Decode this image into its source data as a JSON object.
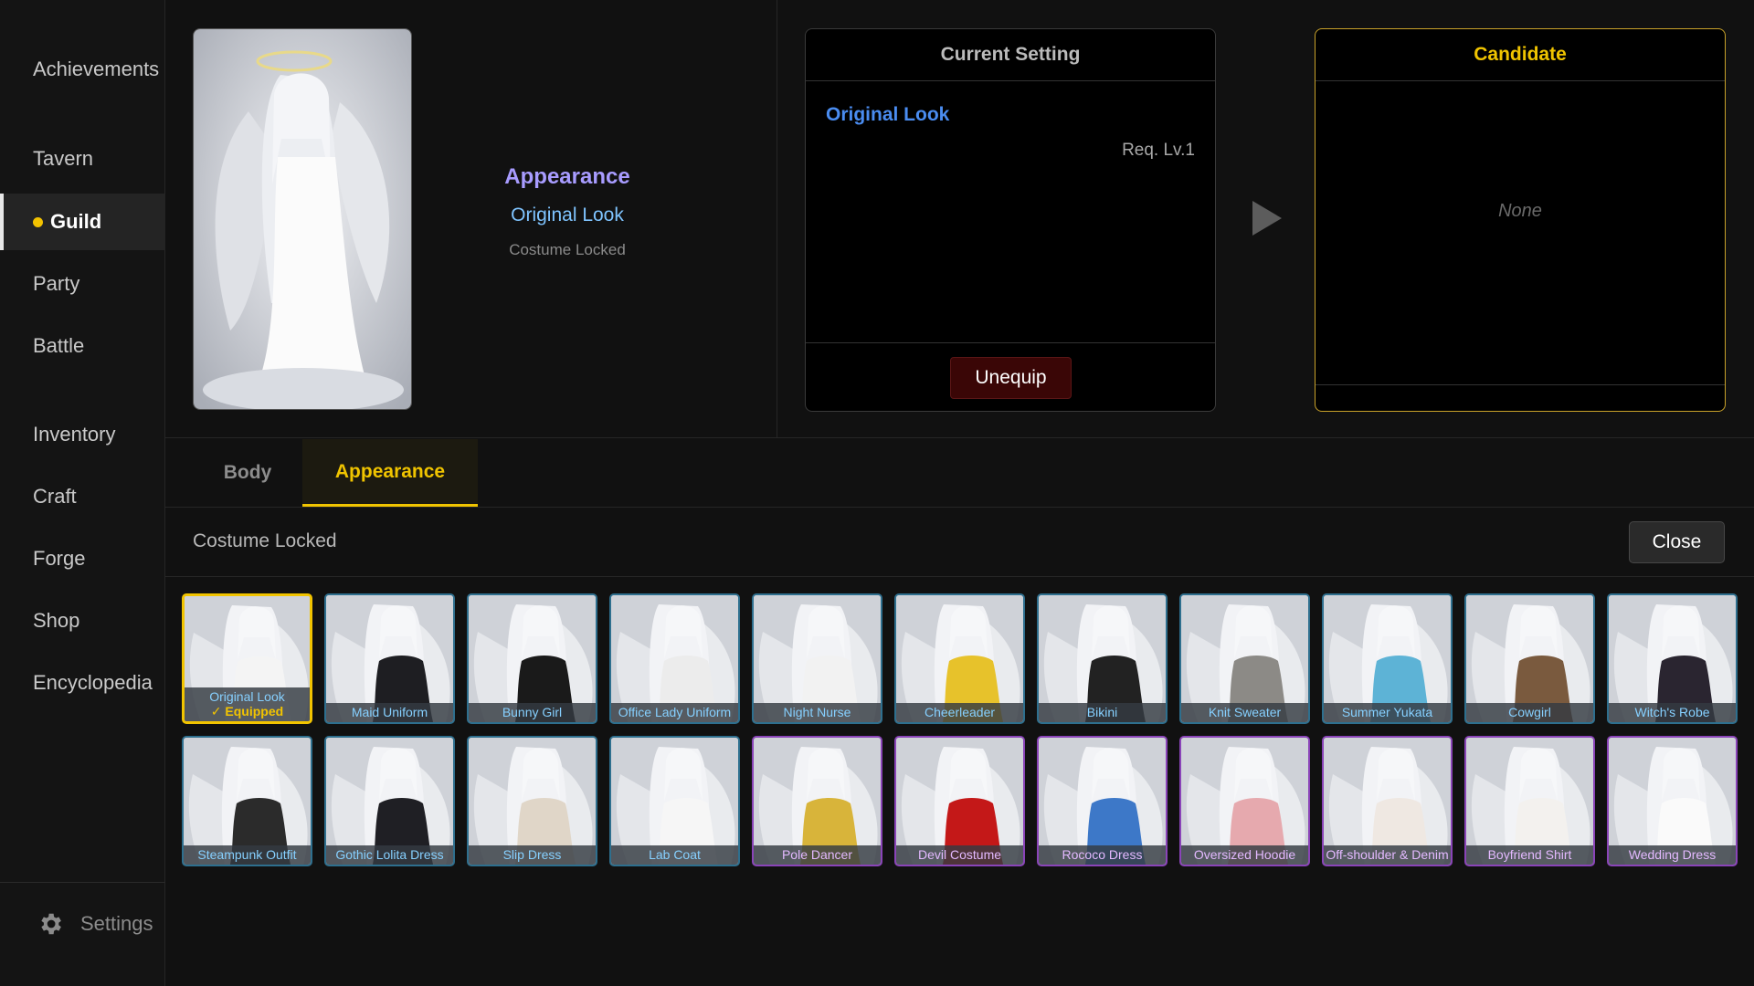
{
  "sidebar": {
    "items": [
      {
        "label": "Achievements",
        "active": false
      },
      {
        "label": "Tavern",
        "active": false
      },
      {
        "label": "Guild",
        "active": true
      },
      {
        "label": "Party",
        "active": false
      },
      {
        "label": "Battle",
        "active": false
      },
      {
        "label": "Inventory",
        "active": false
      },
      {
        "label": "Craft",
        "active": false
      },
      {
        "label": "Forge",
        "active": false
      },
      {
        "label": "Shop",
        "active": false
      },
      {
        "label": "Encyclopedia",
        "active": false
      }
    ],
    "settings_label": "Settings"
  },
  "summary": {
    "heading": "Appearance",
    "current_look": "Original Look",
    "status": "Costume Locked"
  },
  "current_setting": {
    "title": "Current Setting",
    "name": "Original Look",
    "requirement": "Req. Lv.1",
    "unequip_label": "Unequip"
  },
  "candidate": {
    "title": "Candidate",
    "value": "None"
  },
  "tabs": [
    {
      "label": "Body",
      "active": false
    },
    {
      "label": "Appearance",
      "active": true
    }
  ],
  "costume_panel": {
    "status": "Costume Locked",
    "close_label": "Close"
  },
  "costumes": [
    {
      "name": "Original Look",
      "badge": "✓ Equipped",
      "rarity": "selected",
      "outfit": "#f4f4f4"
    },
    {
      "name": "Maid Uniform",
      "rarity": "common",
      "outfit": "#1e1e22"
    },
    {
      "name": "Bunny Girl",
      "rarity": "common",
      "outfit": "#1a1a1a"
    },
    {
      "name": "Office Lady Uniform",
      "rarity": "common",
      "outfit": "#ececec"
    },
    {
      "name": "Night Nurse",
      "rarity": "common",
      "outfit": "#f2f2f2"
    },
    {
      "name": "Cheerleader",
      "rarity": "common",
      "outfit": "#e7c22b"
    },
    {
      "name": "Bikini",
      "rarity": "common",
      "outfit": "#222222"
    },
    {
      "name": "Knit Sweater",
      "rarity": "common",
      "outfit": "#8c8a86"
    },
    {
      "name": "Summer Yukata",
      "rarity": "common",
      "outfit": "#5db3d6"
    },
    {
      "name": "Cowgirl",
      "rarity": "common",
      "outfit": "#7a5a3e"
    },
    {
      "name": "Witch's Robe",
      "rarity": "common",
      "outfit": "#2a2530"
    },
    {
      "name": "Steampunk Outfit",
      "rarity": "common",
      "outfit": "#2b2b2b"
    },
    {
      "name": "Gothic Lolita Dress",
      "rarity": "common",
      "outfit": "#1f1f24"
    },
    {
      "name": "Slip Dress",
      "rarity": "common",
      "outfit": "#e0d6c8"
    },
    {
      "name": "Lab Coat",
      "rarity": "common",
      "outfit": "#f6f6f6"
    },
    {
      "name": "Pole Dancer",
      "rarity": "rare",
      "outfit": "#d8b43a"
    },
    {
      "name": "Devil Costume",
      "rarity": "rare",
      "outfit": "#c41818"
    },
    {
      "name": "Rococo Dress",
      "rarity": "rare",
      "outfit": "#3d78c8"
    },
    {
      "name": "Oversized Hoodie",
      "rarity": "rare",
      "outfit": "#e6a9ae"
    },
    {
      "name": "Off-shoulder & Denim",
      "rarity": "rare",
      "outfit": "#efe8e2"
    },
    {
      "name": "Boyfriend Shirt",
      "rarity": "rare",
      "outfit": "#f3f1ee"
    },
    {
      "name": "Wedding Dress",
      "rarity": "rare",
      "outfit": "#fafafa"
    }
  ]
}
